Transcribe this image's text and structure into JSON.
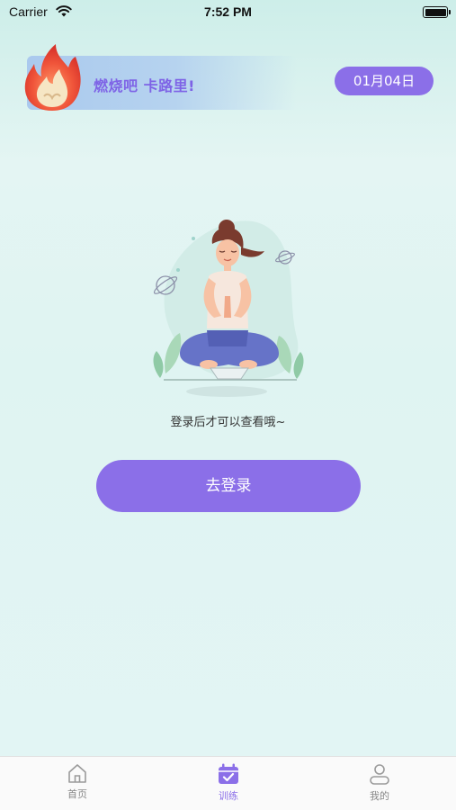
{
  "status_bar": {
    "carrier": "Carrier",
    "time": "7:52 PM"
  },
  "header": {
    "slogan": "燃烧吧 卡路里!",
    "date": "01月04日"
  },
  "main": {
    "hint": "登录后才可以查看哦~",
    "login_label": "去登录"
  },
  "tabs": [
    {
      "label": "首页",
      "icon": "home-icon",
      "active": false
    },
    {
      "label": "训练",
      "icon": "calendar-check-icon",
      "active": true
    },
    {
      "label": "我的",
      "icon": "user-icon",
      "active": false
    }
  ],
  "colors": {
    "accent": "#8b6fe8",
    "inactive_tab": "#888888",
    "background": "#dff4f2"
  }
}
